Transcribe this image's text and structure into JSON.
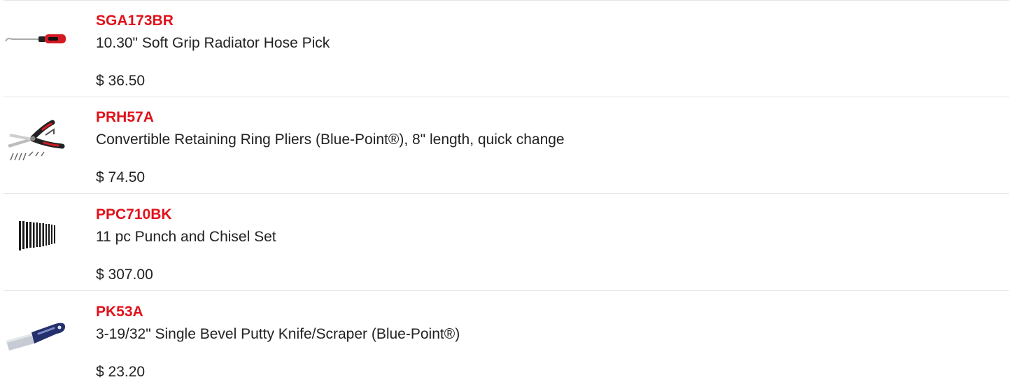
{
  "colors": {
    "sku": "#e0121b",
    "text": "#222222",
    "divider": "#e6e6e6"
  },
  "products": [
    {
      "sku": "SGA173BR",
      "description": "10.30\" Soft Grip Radiator Hose Pick",
      "price": "$ 36.50",
      "icon": "radiator-hose-pick-icon"
    },
    {
      "sku": "PRH57A",
      "description": "Convertible Retaining Ring Pliers (Blue-Point®), 8\" length, quick change",
      "price": "$ 74.50",
      "icon": "retaining-ring-pliers-icon"
    },
    {
      "sku": "PPC710BK",
      "description": "11 pc Punch and Chisel Set",
      "price": "$ 307.00",
      "icon": "punch-chisel-set-icon"
    },
    {
      "sku": "PK53A",
      "description": "3-19/32\" Single Bevel Putty Knife/Scraper (Blue-Point®)",
      "price": "$ 23.20",
      "icon": "putty-knife-icon"
    }
  ]
}
